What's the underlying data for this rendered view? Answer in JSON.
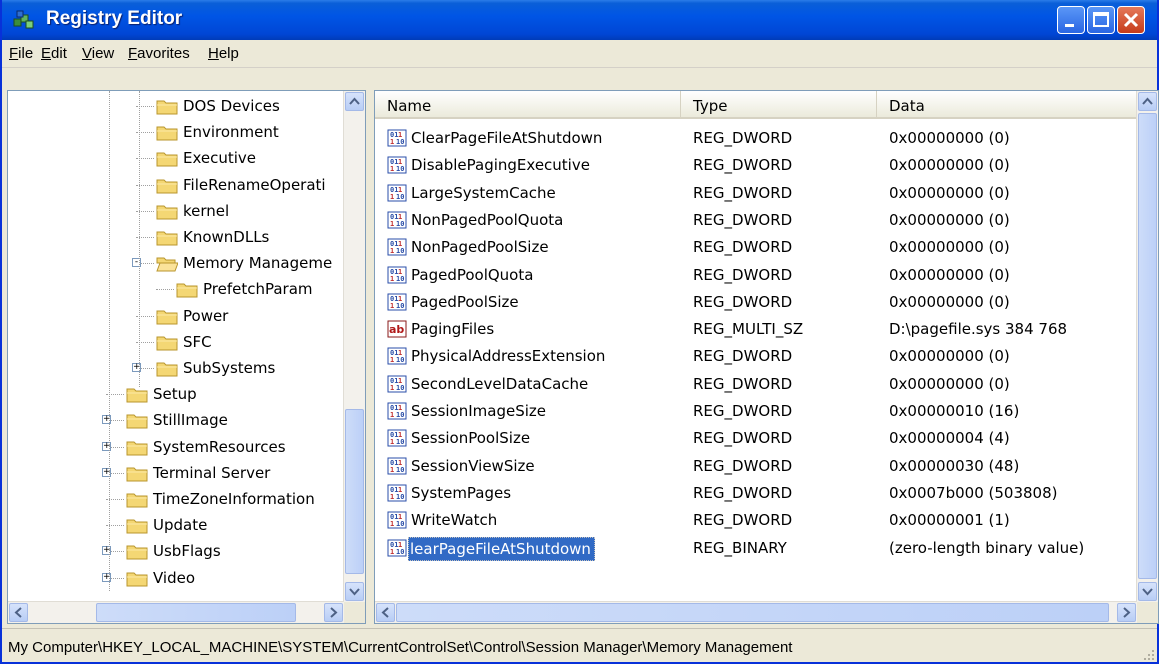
{
  "window": {
    "title": "Registry Editor"
  },
  "menu": [
    "File",
    "Edit",
    "View",
    "Favorites",
    "Help"
  ],
  "tree": {
    "items": [
      {
        "label": "DOS Devices",
        "expander": null
      },
      {
        "label": "Environment",
        "expander": null
      },
      {
        "label": "Executive",
        "expander": null
      },
      {
        "label": "FileRenameOperati",
        "expander": null
      },
      {
        "label": "kernel",
        "expander": null
      },
      {
        "label": "KnownDLLs",
        "expander": null
      },
      {
        "label": "Memory Manageme",
        "expander": "-"
      },
      {
        "label": "PrefetchParam",
        "expander": null
      },
      {
        "label": "Power",
        "expander": null
      },
      {
        "label": "SFC",
        "expander": null
      },
      {
        "label": "SubSystems",
        "expander": "+"
      },
      {
        "label": "Setup",
        "expander": null
      },
      {
        "label": "StillImage",
        "expander": "+"
      },
      {
        "label": "SystemResources",
        "expander": "+"
      },
      {
        "label": "Terminal Server",
        "expander": "+"
      },
      {
        "label": "TimeZoneInformation",
        "expander": null
      },
      {
        "label": "Update",
        "expander": null
      },
      {
        "label": "UsbFlags",
        "expander": "+"
      },
      {
        "label": "Video",
        "expander": "+"
      }
    ]
  },
  "list": {
    "headers": {
      "name": "Name",
      "type": "Type",
      "data": "Data"
    },
    "rows": [
      {
        "name": "ClearPageFileAtShutdown",
        "type": "REG_DWORD",
        "data": "0x00000000 (0)",
        "icon": "dword"
      },
      {
        "name": "DisablePagingExecutive",
        "type": "REG_DWORD",
        "data": "0x00000000 (0)",
        "icon": "dword"
      },
      {
        "name": "LargeSystemCache",
        "type": "REG_DWORD",
        "data": "0x00000000 (0)",
        "icon": "dword"
      },
      {
        "name": "NonPagedPoolQuota",
        "type": "REG_DWORD",
        "data": "0x00000000 (0)",
        "icon": "dword"
      },
      {
        "name": "NonPagedPoolSize",
        "type": "REG_DWORD",
        "data": "0x00000000 (0)",
        "icon": "dword"
      },
      {
        "name": "PagedPoolQuota",
        "type": "REG_DWORD",
        "data": "0x00000000 (0)",
        "icon": "dword"
      },
      {
        "name": "PagedPoolSize",
        "type": "REG_DWORD",
        "data": "0x00000000 (0)",
        "icon": "dword"
      },
      {
        "name": "PagingFiles",
        "type": "REG_MULTI_SZ",
        "data": "D:\\pagefile.sys 384 768",
        "icon": "string"
      },
      {
        "name": "PhysicalAddressExtension",
        "type": "REG_DWORD",
        "data": "0x00000000 (0)",
        "icon": "dword"
      },
      {
        "name": "SecondLevelDataCache",
        "type": "REG_DWORD",
        "data": "0x00000000 (0)",
        "icon": "dword"
      },
      {
        "name": "SessionImageSize",
        "type": "REG_DWORD",
        "data": "0x00000010 (16)",
        "icon": "dword"
      },
      {
        "name": "SessionPoolSize",
        "type": "REG_DWORD",
        "data": "0x00000004 (4)",
        "icon": "dword"
      },
      {
        "name": "SessionViewSize",
        "type": "REG_DWORD",
        "data": "0x00000030 (48)",
        "icon": "dword"
      },
      {
        "name": "SystemPages",
        "type": "REG_DWORD",
        "data": "0x0007b000 (503808)",
        "icon": "dword"
      },
      {
        "name": "WriteWatch",
        "type": "REG_DWORD",
        "data": "0x00000001 (1)",
        "icon": "dword"
      },
      {
        "name": "learPageFileAtShutdown",
        "type": "REG_BINARY",
        "data": "(zero-length binary value)",
        "icon": "binary",
        "selected": true
      }
    ]
  },
  "status": {
    "path": "My Computer\\HKEY_LOCAL_MACHINE\\SYSTEM\\CurrentControlSet\\Control\\Session Manager\\Memory Management"
  },
  "colors": {
    "titlebar": "#0055e5",
    "selection": "#316ac5",
    "folder": "#f4d774"
  }
}
